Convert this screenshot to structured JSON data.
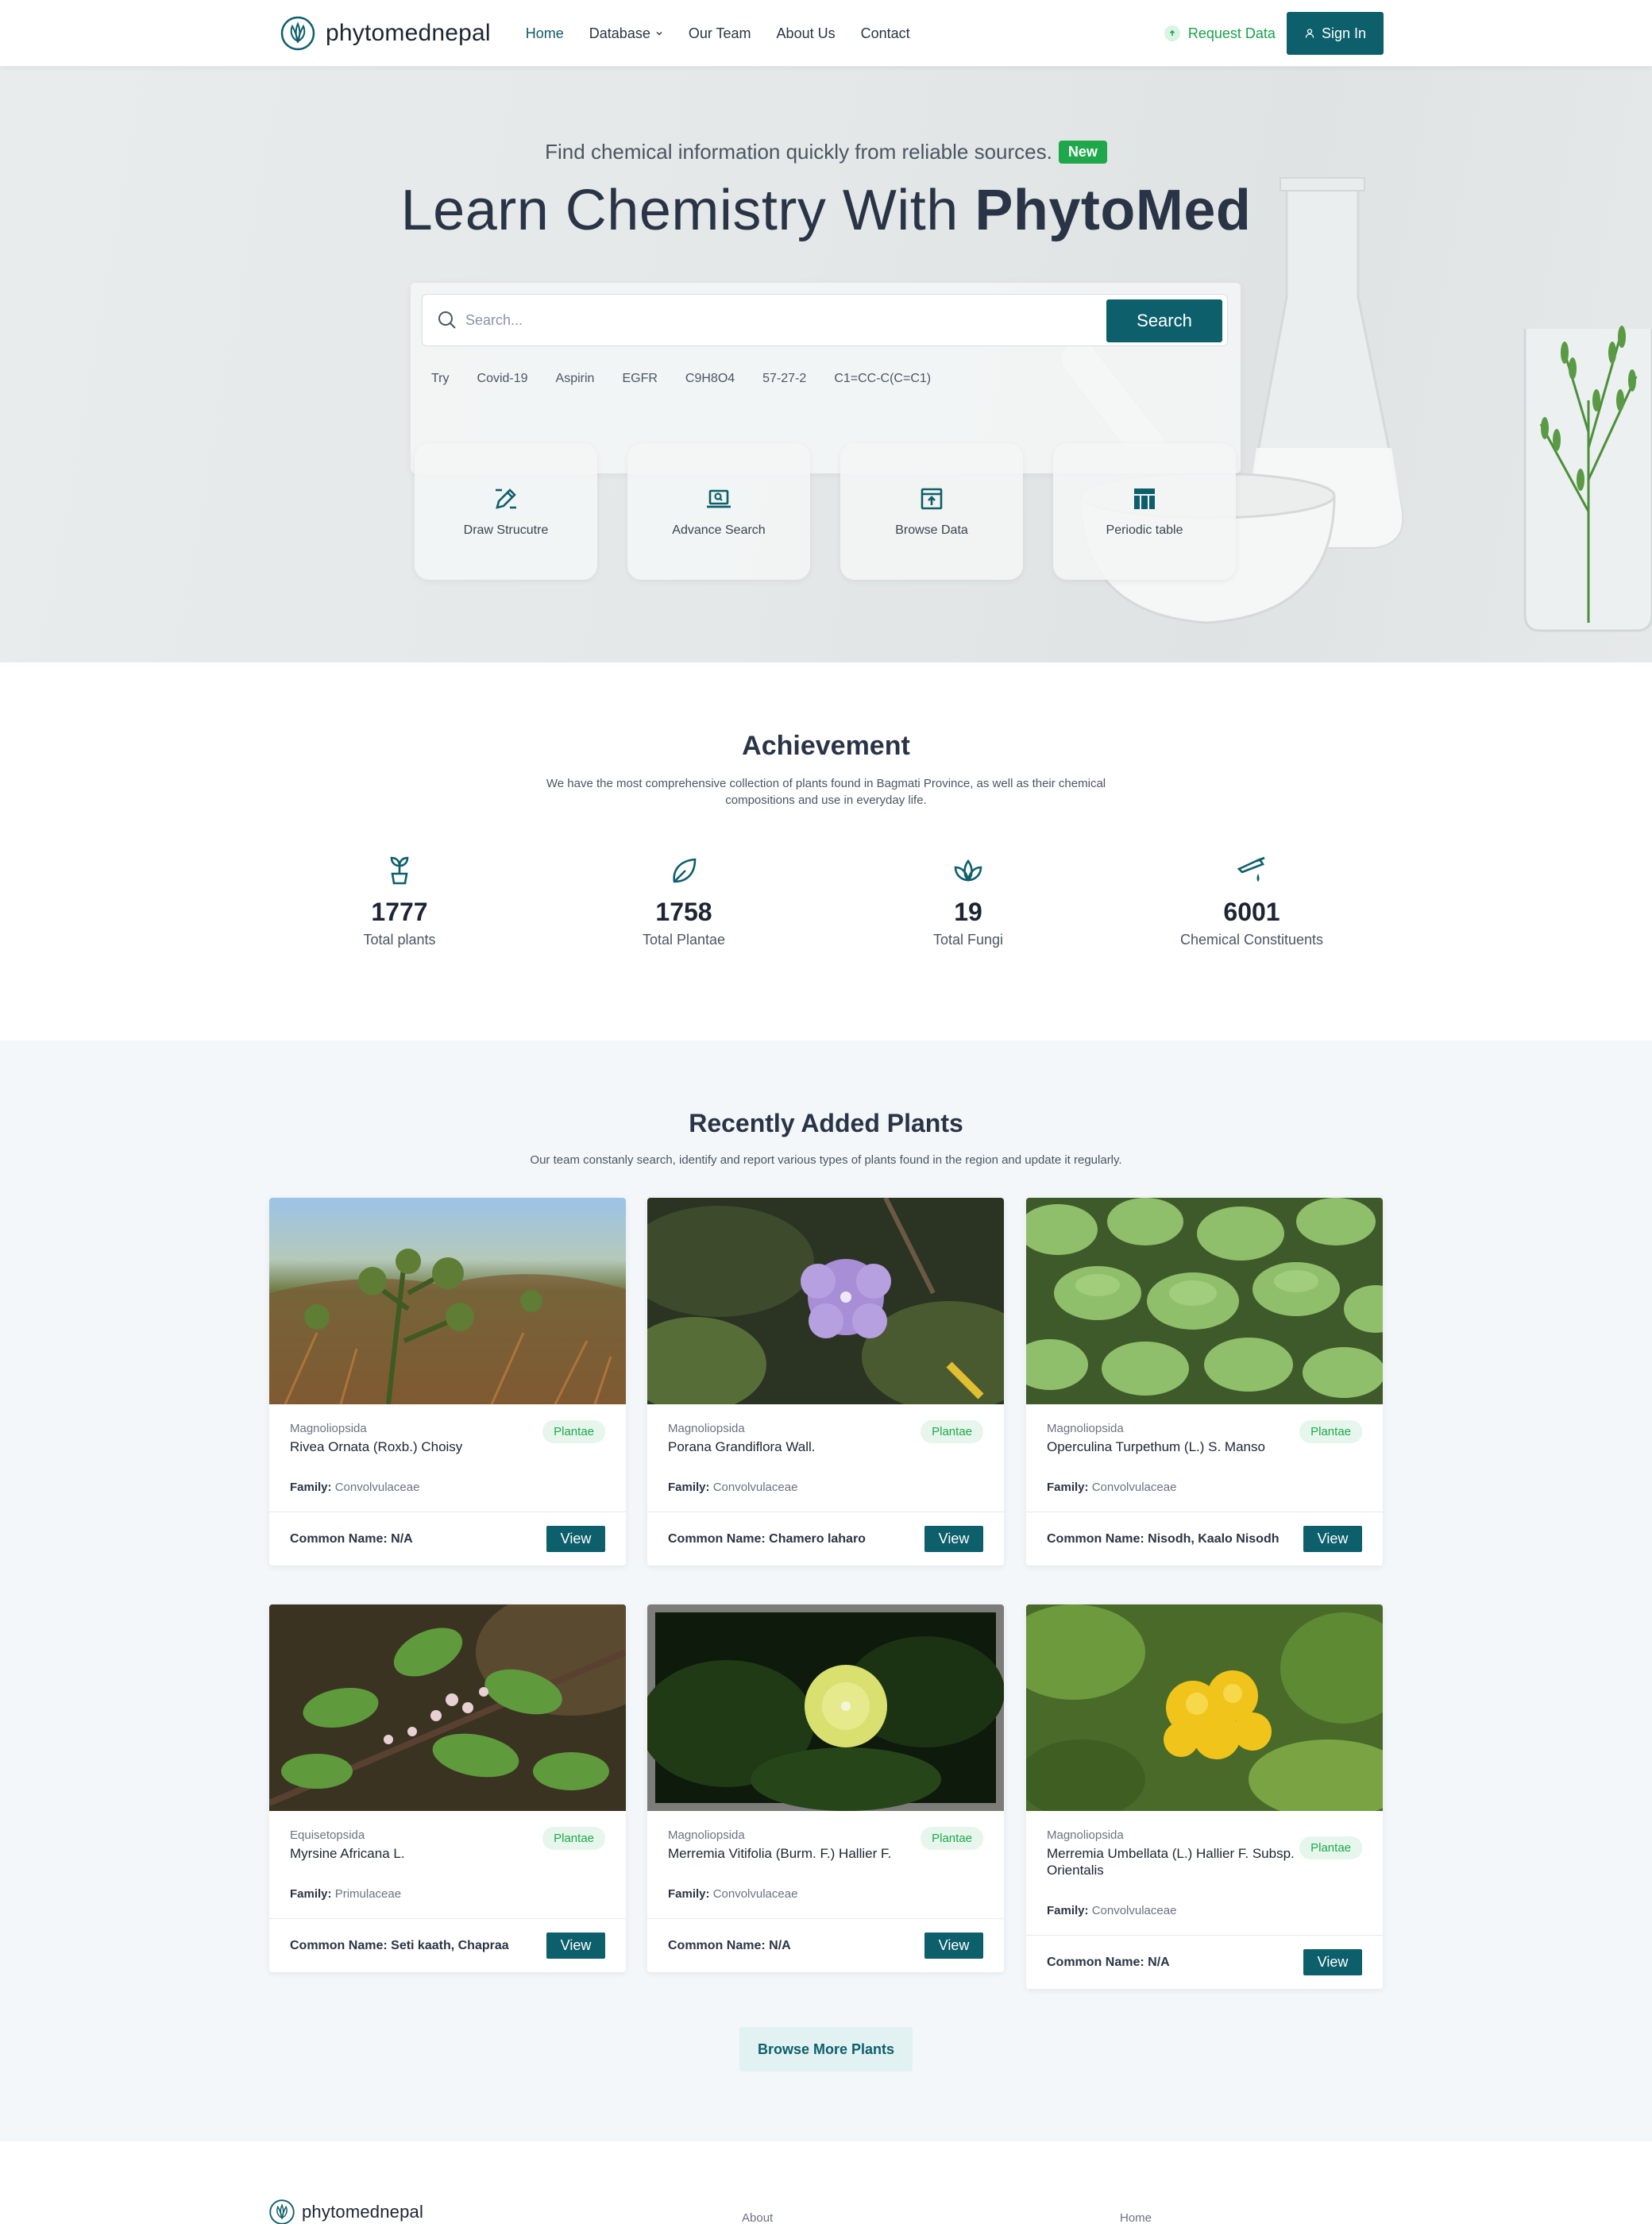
{
  "nav": {
    "brand": "phytomednepal",
    "links": [
      "Home",
      "Database",
      "Our Team",
      "About Us",
      "Contact"
    ],
    "request_data": "Request Data",
    "sign_in": "Sign In"
  },
  "hero": {
    "tagline": "Find chemical information quickly from reliable sources.",
    "badge": "New",
    "title_prefix": "Learn Chemistry With ",
    "title_bold": "PhytoMed",
    "search_placeholder": "Search...",
    "search_button": "Search",
    "try_label": "Try",
    "try_chips": [
      "Covid-19",
      "Aspirin",
      "EGFR",
      "C9H8O4",
      "57-27-2",
      "C1=CC-C(C=C1)"
    ],
    "tools": [
      "Draw Strucutre",
      "Advance Search",
      "Browse Data",
      "Periodic table"
    ]
  },
  "achievement": {
    "title": "Achievement",
    "subtitle": "We have the most comprehensive collection of plants found in Bagmati Province, as well as their chemical compositions and use in everyday life.",
    "stats": [
      {
        "value": "1777",
        "label": "Total plants"
      },
      {
        "value": "1758",
        "label": "Total Plantae"
      },
      {
        "value": "19",
        "label": "Total Fungi"
      },
      {
        "value": "6001",
        "label": "Chemical Constituents"
      }
    ]
  },
  "recent": {
    "title": "Recently Added Plants",
    "subtitle": "Our team constanly search, identify and report various types of plants found in the region and update it regularly.",
    "family_label": "Family:",
    "common_label": "Common Name:",
    "view_label": "View",
    "browse_more": "Browse More Plants",
    "plants": [
      {
        "class": "Magnoliopsida",
        "name": "Rivea Ornata (Roxb.) Choisy",
        "kingdom": "Plantae",
        "family": "Convolvulaceae",
        "common": "N/A"
      },
      {
        "class": "Magnoliopsida",
        "name": "Porana Grandiflora Wall.",
        "kingdom": "Plantae",
        "family": "Convolvulaceae",
        "common": "Chamero laharo"
      },
      {
        "class": "Magnoliopsida",
        "name": "Operculina Turpethum (L.) S. Manso",
        "kingdom": "Plantae",
        "family": "Convolvulaceae",
        "common": "Nisodh, Kaalo Nisodh"
      },
      {
        "class": "Equisetopsida",
        "name": "Myrsine Africana L.",
        "kingdom": "Plantae",
        "family": "Primulaceae",
        "common": "Seti kaath, Chapraa"
      },
      {
        "class": "Magnoliopsida",
        "name": "Merremia Vitifolia (Burm. F.) Hallier F.",
        "kingdom": "Plantae",
        "family": "Convolvulaceae",
        "common": "N/A"
      },
      {
        "class": "Magnoliopsida",
        "name": "Merremia Umbellata (L.) Hallier F. Subsp. Orientalis",
        "kingdom": "Plantae",
        "family": "Convolvulaceae",
        "common": "N/A"
      }
    ]
  },
  "footer": {
    "brand": "phytomednepal",
    "links": [
      "About",
      "Home"
    ]
  },
  "colors": {
    "primary": "#0d5f6b",
    "accent_green": "#1ea84b",
    "section_bg": "#f3f7fa"
  },
  "icons": [
    "logo-icon",
    "chevron-down-icon",
    "upload-icon",
    "user-icon",
    "search-icon",
    "pencil-icon",
    "laptop-search-icon",
    "browse-icon",
    "table-icon",
    "sprout-icon",
    "leaf-icon",
    "lotus-icon",
    "pipette-icon"
  ]
}
